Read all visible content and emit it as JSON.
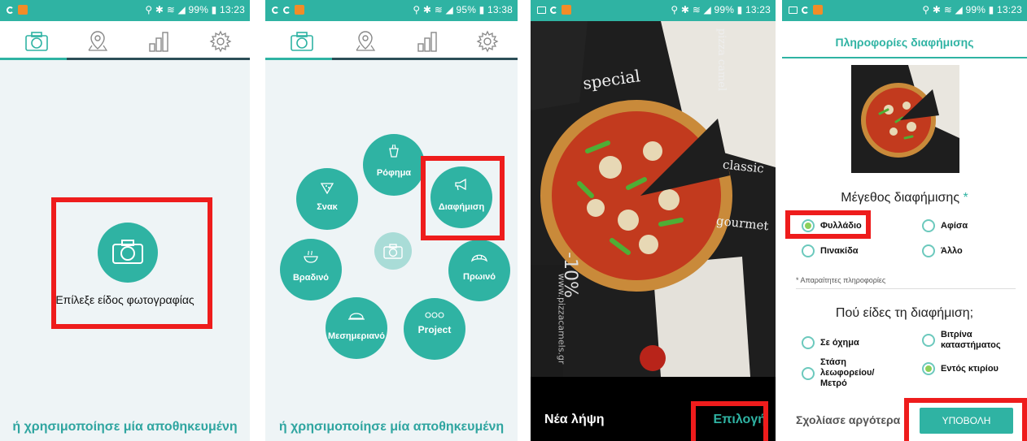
{
  "statusbar": {
    "screen1": "⚲ ✱ ≋ ◢ 99% ▮ 13:23",
    "screen2": "⚲ ✱ ≋ ◢ 95% ▮ 13:38",
    "screen3": "⚲ ✱ ≋ ◢ 99% ▮ 13:23",
    "screen4": "⚲ ✱ ≋ ◢ 99% ▮ 13:23"
  },
  "nav_icons": [
    "camera-icon",
    "map-pin-icon",
    "bar-chart-icon",
    "gear-icon"
  ],
  "screen1": {
    "camera_label": "Επίλεξε είδος φωτογραφίας",
    "bottom_link": "ή χρησιμοποίησε μία αποθηκευμένη"
  },
  "screen2": {
    "categories": {
      "drink": "Ρόφημα",
      "snack": "Σνακ",
      "ad": "Διαφήμιση",
      "dinner": "Βραδινό",
      "breakfast": "Πρωινό",
      "lunch": "Μεσημεριανό",
      "project": "Project"
    },
    "bottom_link": "ή χρησιμοποίησε μία αποθηκευμένη"
  },
  "screen3": {
    "retake": "Νέα λήψη",
    "select": "Επιλογή",
    "menu_words": [
      "special",
      "classic",
      "gourmet",
      "pizza camel",
      "www.pizzacamels.gr",
      "-10%"
    ]
  },
  "screen4": {
    "title": "Πληροφορίες διαφήμισης",
    "size_heading": "Μέγεθος διαφήμισης",
    "required_star": "*",
    "size_options": [
      {
        "label": "Φυλλάδιο",
        "selected": true
      },
      {
        "label": "Αφίσα",
        "selected": false
      },
      {
        "label": "Πινακίδα",
        "selected": false
      },
      {
        "label": "Άλλο",
        "selected": false
      }
    ],
    "required_note": "* Απαραίτητες πληροφορίες",
    "where_heading": "Πού είδες τη διαφήμιση;",
    "where_options": [
      {
        "label": "Σε όχημα",
        "selected": false
      },
      {
        "label": "Βιτρίνα καταστήματος",
        "selected": false
      },
      {
        "label": "Στάση λεωφορείου/ Μετρό",
        "selected": false
      },
      {
        "label": "Εντός κτιρίου",
        "selected": true
      }
    ],
    "comment_later": "Σχολίασε αργότερα",
    "submit": "ΥΠΟΒΟΛΗ"
  },
  "colors": {
    "accent": "#2fb3a3",
    "highlight": "#ee1c1c",
    "background": "#eef4f6",
    "navline": "#2c4e57"
  }
}
